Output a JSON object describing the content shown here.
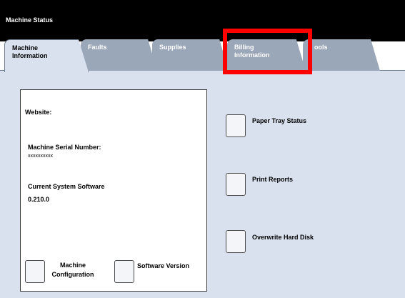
{
  "window": {
    "title": "Machine Status"
  },
  "tabs": [
    {
      "label_line1": "Machine",
      "label_line2": "Information"
    },
    {
      "label_line1": "Faults",
      "label_line2": ""
    },
    {
      "label_line1": "Supplies",
      "label_line2": ""
    },
    {
      "label_line1": "Billing",
      "label_line2": "Information"
    },
    {
      "label_line1": "ools",
      "label_line2": ""
    }
  ],
  "info": {
    "website_label": "Website:",
    "serial_label": "Machine Serial Number:",
    "serial_value": "xxxxxxxxxx",
    "software_label": "Current System Software",
    "software_value": "0.210.0"
  },
  "buttons": {
    "machine_config_line1": "Machine",
    "machine_config_line2": "Configuration",
    "software_version": "Software Version",
    "paper_tray_status": "Paper Tray Status",
    "print_reports": "Print Reports",
    "overwrite_hard_disk": "Overwrite Hard Disk"
  },
  "colors": {
    "highlight": "#ff0000",
    "panel_background": "#d9e1ee",
    "tab_inactive": "#9aa7b9"
  }
}
